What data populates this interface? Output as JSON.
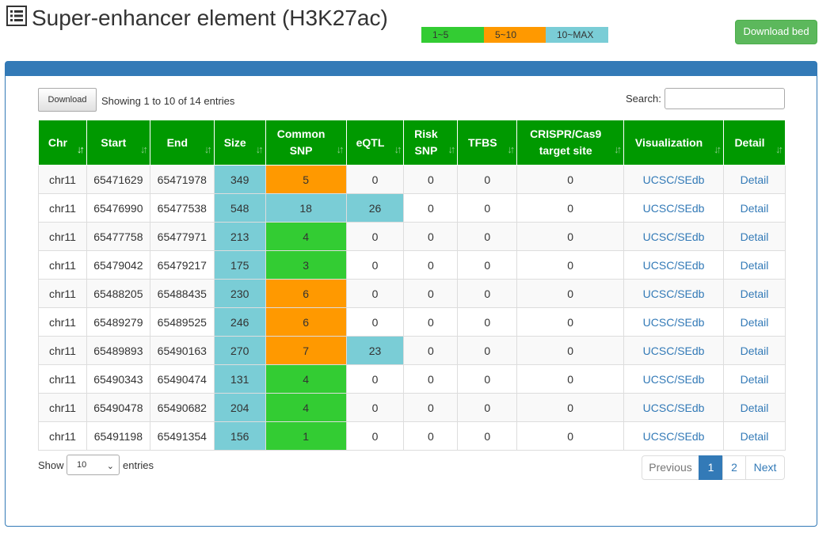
{
  "page": {
    "title": "Super-enhancer element (H3K27ac)",
    "title_icon": "list-icon",
    "download_bed_label": "Download bed"
  },
  "legend": {
    "items": [
      {
        "label": "1~5",
        "color": "#33cc33"
      },
      {
        "label": "5~10",
        "color": "#ff9900"
      },
      {
        "label": "10~MAX",
        "color": "#7acdd6"
      }
    ]
  },
  "colors": {
    "header_green": "#009900",
    "panel_blue": "#337ab7",
    "size_cell": "#7acdd6",
    "low": "#33cc33",
    "mid": "#ff9900",
    "high": "#7acdd6"
  },
  "toolbar": {
    "download_label": "Download",
    "info": "Showing 1 to 10 of 14 entries",
    "search_label": "Search:",
    "search_value": ""
  },
  "table": {
    "columns": [
      "Chr",
      "Start",
      "End",
      "Size",
      "Common SNP",
      "eQTL",
      "Risk SNP",
      "TFBS",
      "CRISPR/Cas9 target site",
      "Visualization",
      "Detail"
    ],
    "rows": [
      {
        "chr": "chr11",
        "start": "65471629",
        "end": "65471978",
        "size": "349",
        "common_snp": "5",
        "snp_level": "mid",
        "eqtl": "0",
        "eqtl_level": "",
        "risk_snp": "0",
        "tfbs": "0",
        "crispr": "0",
        "vis_ucsc": "UCSC",
        "vis_sep": "/",
        "vis_sedb": "SEdb",
        "detail": "Detail"
      },
      {
        "chr": "chr11",
        "start": "65476990",
        "end": "65477538",
        "size": "548",
        "common_snp": "18",
        "snp_level": "high",
        "eqtl": "26",
        "eqtl_level": "high",
        "risk_snp": "0",
        "tfbs": "0",
        "crispr": "0",
        "vis_ucsc": "UCSC",
        "vis_sep": "/",
        "vis_sedb": "SEdb",
        "detail": "Detail"
      },
      {
        "chr": "chr11",
        "start": "65477758",
        "end": "65477971",
        "size": "213",
        "common_snp": "4",
        "snp_level": "low",
        "eqtl": "0",
        "eqtl_level": "",
        "risk_snp": "0",
        "tfbs": "0",
        "crispr": "0",
        "vis_ucsc": "UCSC",
        "vis_sep": "/",
        "vis_sedb": "SEdb",
        "detail": "Detail"
      },
      {
        "chr": "chr11",
        "start": "65479042",
        "end": "65479217",
        "size": "175",
        "common_snp": "3",
        "snp_level": "low",
        "eqtl": "0",
        "eqtl_level": "",
        "risk_snp": "0",
        "tfbs": "0",
        "crispr": "0",
        "vis_ucsc": "UCSC",
        "vis_sep": "/",
        "vis_sedb": "SEdb",
        "detail": "Detail"
      },
      {
        "chr": "chr11",
        "start": "65488205",
        "end": "65488435",
        "size": "230",
        "common_snp": "6",
        "snp_level": "mid",
        "eqtl": "0",
        "eqtl_level": "",
        "risk_snp": "0",
        "tfbs": "0",
        "crispr": "0",
        "vis_ucsc": "UCSC",
        "vis_sep": "/",
        "vis_sedb": "SEdb",
        "detail": "Detail"
      },
      {
        "chr": "chr11",
        "start": "65489279",
        "end": "65489525",
        "size": "246",
        "common_snp": "6",
        "snp_level": "mid",
        "eqtl": "0",
        "eqtl_level": "",
        "risk_snp": "0",
        "tfbs": "0",
        "crispr": "0",
        "vis_ucsc": "UCSC",
        "vis_sep": "/",
        "vis_sedb": "SEdb",
        "detail": "Detail"
      },
      {
        "chr": "chr11",
        "start": "65489893",
        "end": "65490163",
        "size": "270",
        "common_snp": "7",
        "snp_level": "mid",
        "eqtl": "23",
        "eqtl_level": "high",
        "risk_snp": "0",
        "tfbs": "0",
        "crispr": "0",
        "vis_ucsc": "UCSC",
        "vis_sep": "/",
        "vis_sedb": "SEdb",
        "detail": "Detail"
      },
      {
        "chr": "chr11",
        "start": "65490343",
        "end": "65490474",
        "size": "131",
        "common_snp": "4",
        "snp_level": "low",
        "eqtl": "0",
        "eqtl_level": "",
        "risk_snp": "0",
        "tfbs": "0",
        "crispr": "0",
        "vis_ucsc": "UCSC",
        "vis_sep": "/",
        "vis_sedb": "SEdb",
        "detail": "Detail"
      },
      {
        "chr": "chr11",
        "start": "65490478",
        "end": "65490682",
        "size": "204",
        "common_snp": "4",
        "snp_level": "low",
        "eqtl": "0",
        "eqtl_level": "",
        "risk_snp": "0",
        "tfbs": "0",
        "crispr": "0",
        "vis_ucsc": "UCSC",
        "vis_sep": "/",
        "vis_sedb": "SEdb",
        "detail": "Detail"
      },
      {
        "chr": "chr11",
        "start": "65491198",
        "end": "65491354",
        "size": "156",
        "common_snp": "1",
        "snp_level": "low",
        "eqtl": "0",
        "eqtl_level": "",
        "risk_snp": "0",
        "tfbs": "0",
        "crispr": "0",
        "vis_ucsc": "UCSC",
        "vis_sep": "/",
        "vis_sedb": "SEdb",
        "detail": "Detail"
      }
    ]
  },
  "footer": {
    "show_label": "Show",
    "page_size": "10",
    "entries_label": "entries",
    "pagination": {
      "previous": "Previous",
      "pages": [
        "1",
        "2"
      ],
      "active_page": "1",
      "next": "Next"
    }
  }
}
